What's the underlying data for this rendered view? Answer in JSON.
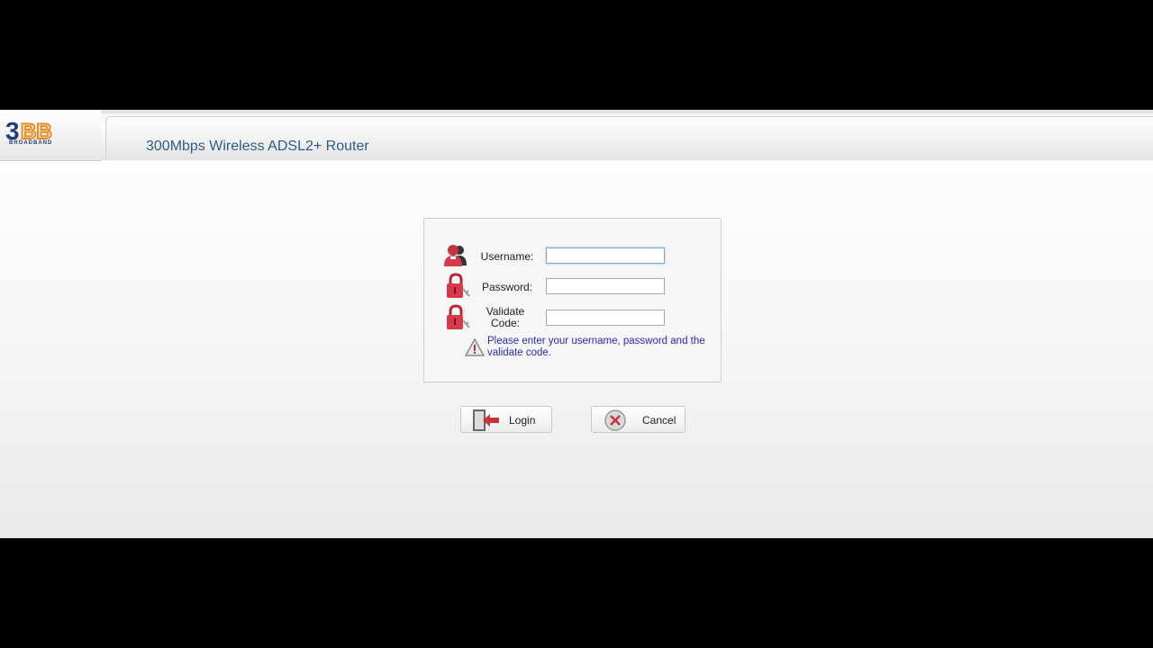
{
  "brand": {
    "logo_text": "3BB",
    "logo_subtext": "BROADBAND",
    "colors": {
      "blue": "#1d3e7a",
      "orange": "#f08a1c"
    }
  },
  "header": {
    "title": "300Mbps Wireless ADSL2+ Router"
  },
  "login": {
    "username_label": "Username:",
    "username_value": "",
    "password_label": "Password:",
    "password_value": "",
    "validate_label": "Validate Code:",
    "validate_value": "",
    "message": "Please enter your username, password and the validate code."
  },
  "buttons": {
    "login": "Login",
    "cancel": "Cancel"
  },
  "icons": [
    "user-icon",
    "lock-icon",
    "warning-icon",
    "door-arrow-icon",
    "cancel-x-icon"
  ]
}
